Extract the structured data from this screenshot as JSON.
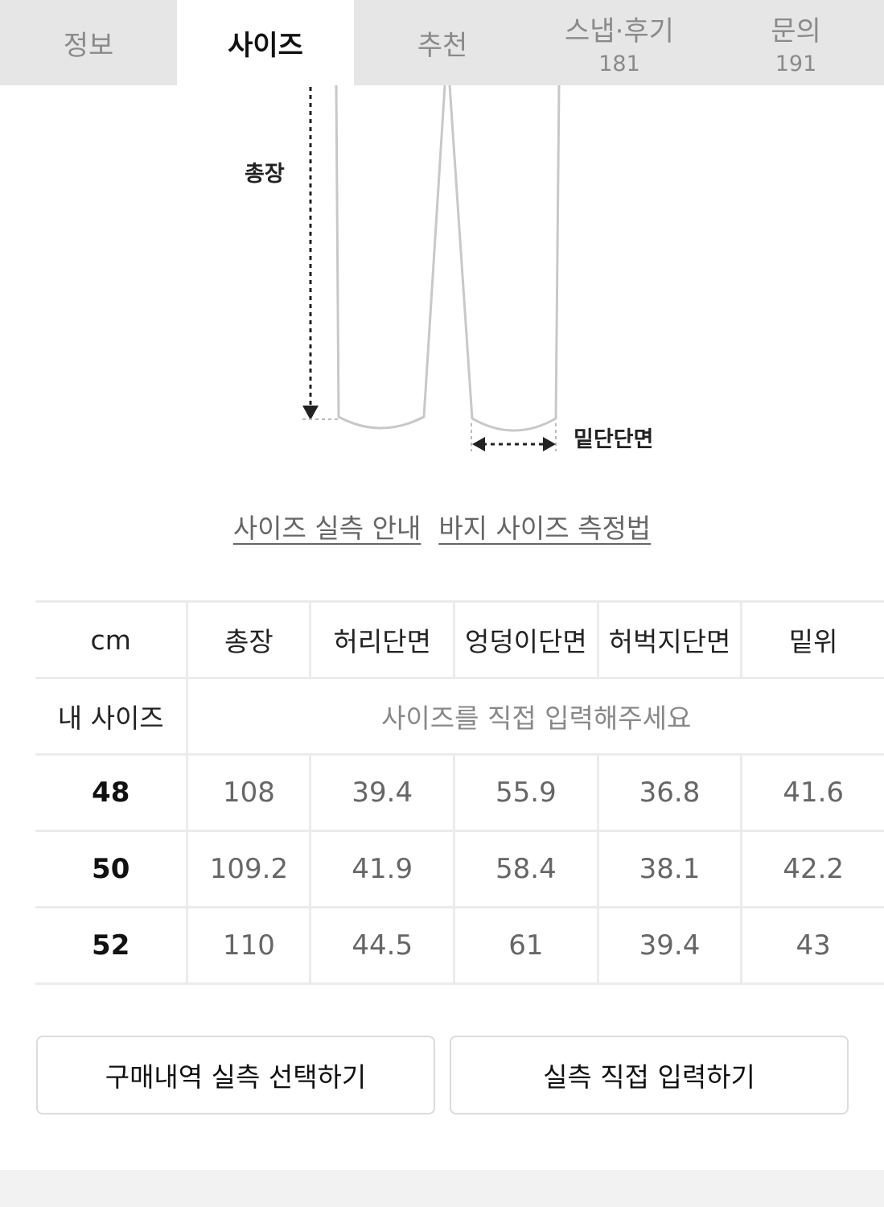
{
  "tabs": [
    {
      "label": "정보",
      "count": ""
    },
    {
      "label": "사이즈",
      "count": ""
    },
    {
      "label": "추천",
      "count": ""
    },
    {
      "label": "스냅·후기",
      "count": "181"
    },
    {
      "label": "문의",
      "count": "191"
    }
  ],
  "active_tab": "사이즈",
  "diagram": {
    "length_label": "총장",
    "hem_label": "밑단단면"
  },
  "guide_links": [
    "사이즈 실측 안내",
    "바지 사이즈 측정법"
  ],
  "size_table": {
    "unit_header": "cm",
    "columns": [
      "총장",
      "허리단면",
      "엉덩이단면",
      "허벅지단면",
      "밑위"
    ],
    "my_size_label": "내 사이즈",
    "my_size_placeholder": "사이즈를 직접 입력해주세요",
    "rows": [
      {
        "size": "48",
        "values": [
          "108",
          "39.4",
          "55.9",
          "36.8",
          "41.6"
        ]
      },
      {
        "size": "50",
        "values": [
          "109.2",
          "41.9",
          "58.4",
          "38.1",
          "42.2"
        ]
      },
      {
        "size": "52",
        "values": [
          "110",
          "44.5",
          "61",
          "39.4",
          "43"
        ]
      }
    ]
  },
  "buttons": {
    "purchase_history": "구매내역 실측 선택하기",
    "manual_input": "실측 직접 입력하기"
  }
}
